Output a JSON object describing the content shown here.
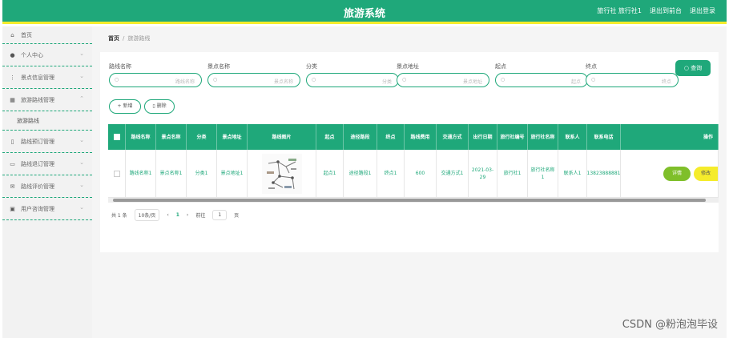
{
  "header": {
    "title": "旅游系统",
    "user_label": "旅行社 旅行社1",
    "back_label": "退出到前台",
    "logout_label": "退出登录"
  },
  "sidebar": {
    "items": [
      {
        "icon": "home-icon",
        "label": "首页"
      },
      {
        "icon": "person-icon",
        "label": "个人中心"
      },
      {
        "icon": "scenic-icon",
        "label": "景点信息管理"
      },
      {
        "icon": "grid-icon",
        "label": "旅游路线管理"
      },
      {
        "icon": "booking-icon",
        "label": "路线预订管理"
      },
      {
        "icon": "order-icon",
        "label": "路线退订管理"
      },
      {
        "icon": "review-icon",
        "label": "路线评价管理"
      },
      {
        "icon": "user-icon",
        "label": "用户咨询管理"
      }
    ],
    "submenu": {
      "label": "旅游路线"
    }
  },
  "breadcrumb": {
    "home": "首页",
    "current": "旅游路线"
  },
  "filters": [
    {
      "label": "路线名称",
      "placeholder": "路线名称"
    },
    {
      "label": "景点名称",
      "placeholder": "景点名称"
    },
    {
      "label": "分类",
      "placeholder": "分类"
    },
    {
      "label": "景点地址",
      "placeholder": "景点地址"
    },
    {
      "label": "起点",
      "placeholder": "起点"
    },
    {
      "label": "终点",
      "placeholder": "终点"
    }
  ],
  "buttons": {
    "query": "查询",
    "add": "新增",
    "delete": "删除"
  },
  "table": {
    "headers": [
      "路线名称",
      "景点名称",
      "分类",
      "景点地址",
      "路线图片",
      "起点",
      "途径路段",
      "终点",
      "路线费用",
      "交通方式",
      "出行日期",
      "旅行社编号",
      "旅行社名称",
      "联系人",
      "联系电话",
      "操作"
    ],
    "row": {
      "route_name": "路线名称1",
      "spot_name": "景点名称1",
      "category": "分类1",
      "address": "景点地址1",
      "start": "起点1",
      "via": "途径路段1",
      "end": "终点1",
      "cost": "600",
      "transport": "交通方式1",
      "date": "2021-03-29",
      "agency_no": "旅行社1",
      "agency_name": "旅行社名称1",
      "contact": "联系人1",
      "phone": "13823888881",
      "detail": "详情",
      "edit": "修改"
    }
  },
  "pagination": {
    "total": "共 1 条",
    "page_size": "10条/页",
    "prev": "‹",
    "current": "1",
    "next": "›",
    "goto_prefix": "前往",
    "goto_value": "1",
    "goto_suffix": "页"
  },
  "watermark": "CSDN @粉泡泡毕设",
  "colors": {
    "primary": "#1fa87a",
    "accent": "#f5ec2b",
    "detail": "#7fbf2a"
  }
}
